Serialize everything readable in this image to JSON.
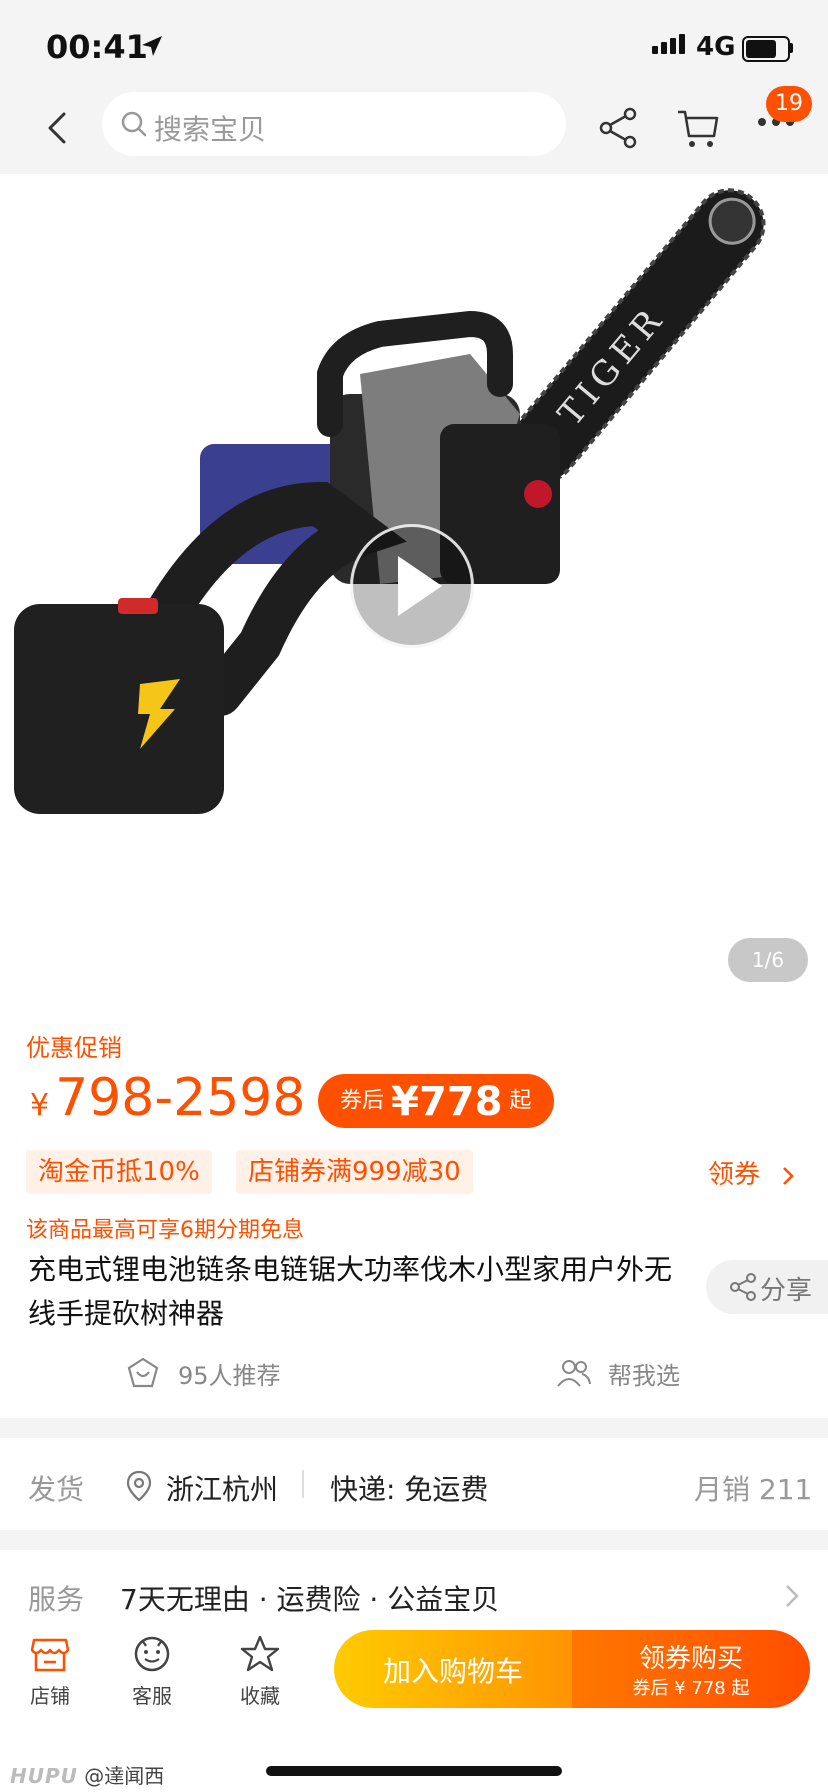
{
  "status_bar": {
    "time": "00:41",
    "network": "4G"
  },
  "nav": {
    "search_placeholder": "搜索宝贝",
    "badge_count": "19"
  },
  "gallery": {
    "pager": "1/6"
  },
  "price_section": {
    "promo_title": "优惠促销",
    "currency": "¥",
    "price_range": "798-2598",
    "coupon_prefix": "券后",
    "coupon_price": "¥778",
    "coupon_suffix": "起",
    "tags": [
      "淘金币抵10%",
      "店铺券满999减30"
    ],
    "get_coupon": "领券",
    "installment": "该商品最高可享6期分期免息"
  },
  "product": {
    "title": "充电式锂电池链条电链锯大功率伐木小型家用户外无线手提砍树神器",
    "share_label": "分享",
    "recommend": "95人推荐",
    "help_choose": "帮我选"
  },
  "shipping": {
    "label": "发货",
    "location": "浙江杭州",
    "express": "快递: 免运费",
    "monthly_sales": "月销 211"
  },
  "service": {
    "label": "服务",
    "items": "7天无理由 · 运费险 · 公益宝贝"
  },
  "bottom_bar": {
    "tabs": [
      "店铺",
      "客服",
      "收藏"
    ],
    "add_to_cart": "加入购物车",
    "buy_main": "领券购买",
    "buy_sub": "券后 ¥ 778 起"
  },
  "watermark": {
    "brand": "HUPU",
    "user": "@達闻西"
  },
  "colors": {
    "accent": "#ff5000",
    "cart_gradient": [
      "#ffcb00",
      "#ff9402"
    ],
    "buy_gradient": [
      "#ff7700",
      "#ff4e00"
    ]
  }
}
